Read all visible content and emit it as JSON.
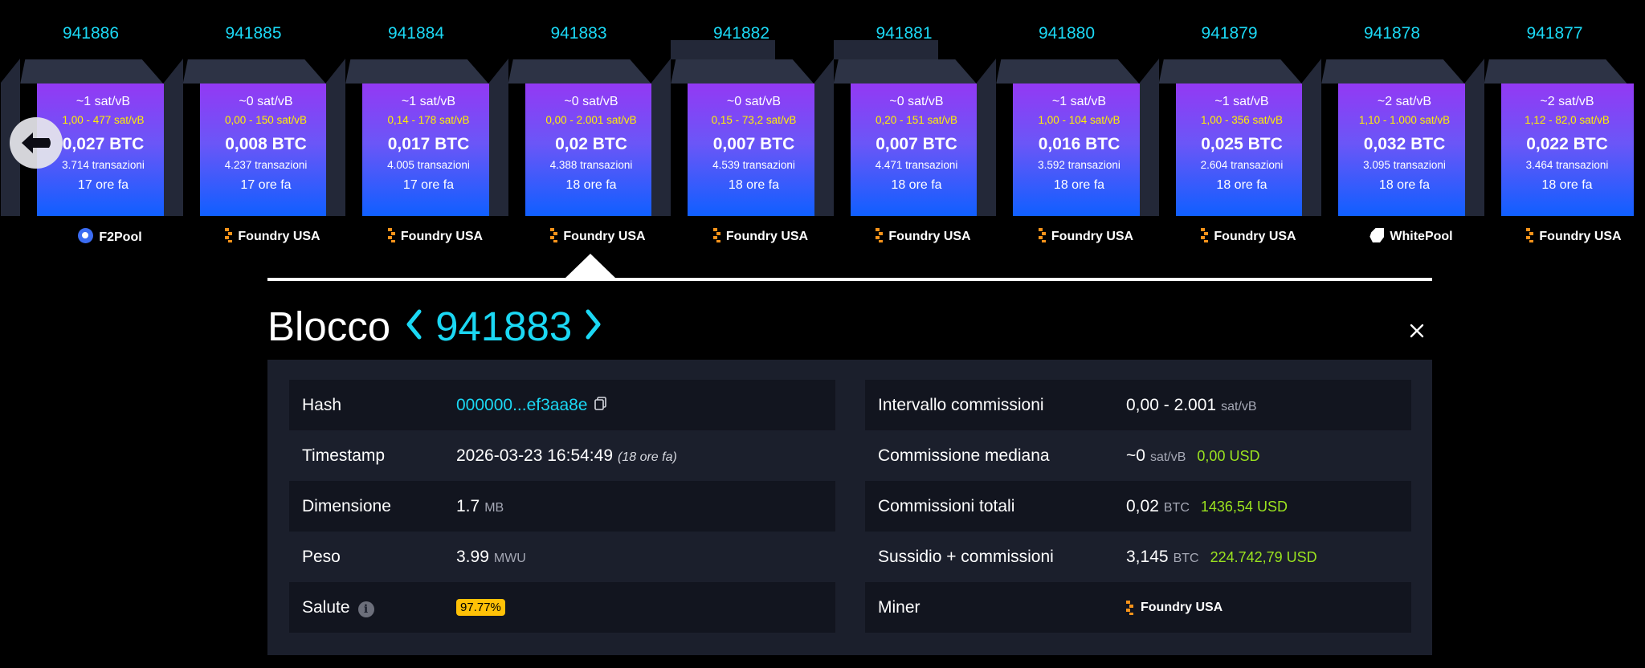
{
  "blocks": [
    {
      "height": "941886",
      "fee": "~1 sat/vB",
      "range": "1,00 - 477 sat/vB",
      "total": "0,027 BTC",
      "tx": "3.714 transazioni",
      "time": "17 ore fa",
      "pool": "F2Pool",
      "pool_icon": "f2pool-icon"
    },
    {
      "height": "941885",
      "fee": "~0 sat/vB",
      "range": "0,00 - 150 sat/vB",
      "total": "0,008 BTC",
      "tx": "4.237 transazioni",
      "time": "17 ore fa",
      "pool": "Foundry USA",
      "pool_icon": "foundry-icon"
    },
    {
      "height": "941884",
      "fee": "~1 sat/vB",
      "range": "0,14 - 178 sat/vB",
      "total": "0,017 BTC",
      "tx": "4.005 transazioni",
      "time": "17 ore fa",
      "pool": "Foundry USA",
      "pool_icon": "foundry-icon"
    },
    {
      "height": "941883",
      "fee": "~0 sat/vB",
      "range": "0,00 - 2.001 sat/vB",
      "total": "0,02 BTC",
      "tx": "4.388 transazioni",
      "time": "18 ore fa",
      "pool": "Foundry USA",
      "pool_icon": "foundry-icon"
    },
    {
      "height": "941882",
      "fee": "~0 sat/vB",
      "range": "0,15 - 73,2 sat/vB",
      "total": "0,007 BTC",
      "tx": "4.539 transazioni",
      "time": "18 ore fa",
      "pool": "Foundry USA",
      "pool_icon": "foundry-icon"
    },
    {
      "height": "941881",
      "fee": "~0 sat/vB",
      "range": "0,20 - 151 sat/vB",
      "total": "0,007 BTC",
      "tx": "4.471 transazioni",
      "time": "18 ore fa",
      "pool": "Foundry USA",
      "pool_icon": "foundry-icon"
    },
    {
      "height": "941880",
      "fee": "~1 sat/vB",
      "range": "1,00 - 104 sat/vB",
      "total": "0,016 BTC",
      "tx": "3.592 transazioni",
      "time": "18 ore fa",
      "pool": "Foundry USA",
      "pool_icon": "foundry-icon"
    },
    {
      "height": "941879",
      "fee": "~1 sat/vB",
      "range": "1,00 - 356 sat/vB",
      "total": "0,025 BTC",
      "tx": "2.604 transazioni",
      "time": "18 ore fa",
      "pool": "Foundry USA",
      "pool_icon": "foundry-icon"
    },
    {
      "height": "941878",
      "fee": "~2 sat/vB",
      "range": "1,10 - 1.000 sat/vB",
      "total": "0,032 BTC",
      "tx": "3.095 transazioni",
      "time": "18 ore fa",
      "pool": "WhitePool",
      "pool_icon": "whitepool-icon"
    },
    {
      "height": "941877",
      "fee": "~2 sat/vB",
      "range": "1,12 - 82,0 sat/vB",
      "total": "0,022 BTC",
      "tx": "3.464 transazioni",
      "time": "18 ore fa",
      "pool": "Foundry USA",
      "pool_icon": "foundry-icon"
    }
  ],
  "detail": {
    "title_word": "Blocco",
    "height": "941883",
    "left": {
      "hash_label": "Hash",
      "hash_value": "000000...ef3aa8e",
      "timestamp_label": "Timestamp",
      "timestamp_value": "2026-03-23 16:54:49",
      "timestamp_ago": "(18 ore fa)",
      "size_label": "Dimensione",
      "size_value": "1.7",
      "size_unit": "MB",
      "weight_label": "Peso",
      "weight_value": "3.99",
      "weight_unit": "MWU",
      "health_label": "Salute",
      "health_value": "97.77%"
    },
    "right": {
      "fee_range_label": "Intervallo commissioni",
      "fee_range_value": "0,00 - 2.001",
      "fee_range_unit": "sat/vB",
      "median_label": "Commissione mediana",
      "median_value": "~0",
      "median_unit": "sat/vB",
      "median_usd": "0,00 USD",
      "total_fees_label": "Commissioni totali",
      "total_fees_value": "0,02",
      "total_fees_unit": "BTC",
      "total_fees_usd": "1436,54 USD",
      "subsidy_label": "Sussidio + commissioni",
      "subsidy_value": "3,145",
      "subsidy_unit": "BTC",
      "subsidy_usd": "224.742,79 USD",
      "miner_label": "Miner",
      "miner_value": "Foundry USA"
    }
  },
  "colors": {
    "accent": "#1bd8f4",
    "fee_range": "#fff000",
    "usd": "#9be31f",
    "health_badge": "#ffc107",
    "foundry": "#f7931a"
  }
}
